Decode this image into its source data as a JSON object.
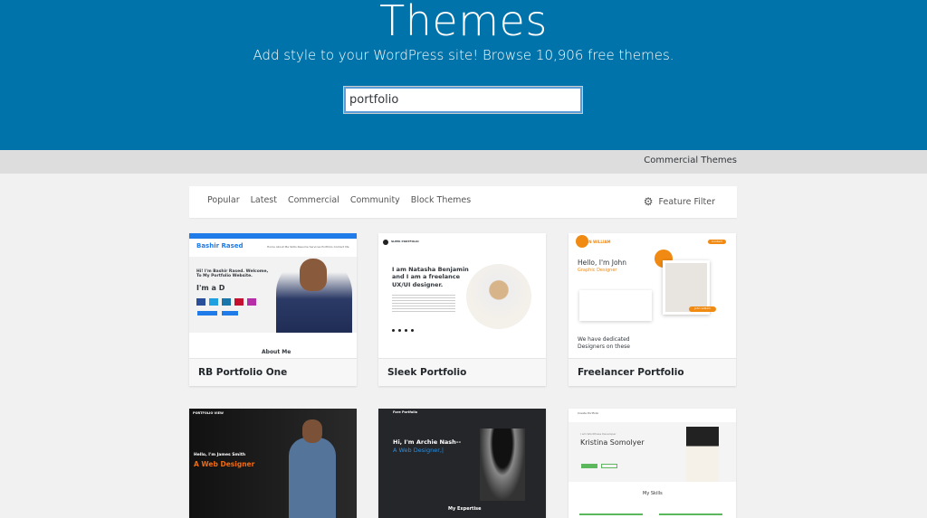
{
  "hero": {
    "title": "Themes",
    "subtitle": "Add style to your WordPress site! Browse 10,906 free themes.",
    "search_value": "portfolio"
  },
  "subbar": {
    "commercial_link": "Commercial Themes"
  },
  "filter": {
    "tabs": [
      "Popular",
      "Latest",
      "Commercial",
      "Community",
      "Block Themes"
    ],
    "feature_filter": "Feature Filter",
    "icon": "gear-icon"
  },
  "themes": [
    {
      "name": "RB Portfolio One",
      "preview": {
        "brand": "Bashir Rased",
        "intro": "Hi! I'm Bashir Rased. Welcome, To My Portfolio Website.",
        "typed": "I'm a D",
        "section": "About Me",
        "nav": "Home  About Me  Skills  Resume  Services  Portfolio  Contact Me"
      }
    },
    {
      "name": "Sleek Portfolio",
      "preview": {
        "brand": "SLEEK PORTFOLIO",
        "headline": "I am Natasha Benjamin and I am a freelance UX/UI designer."
      }
    },
    {
      "name": "Freelancer Portfolio",
      "preview": {
        "brand": "JOHN WILLIAM",
        "headline": "Hello, I'm John",
        "role": "Graphic Designer",
        "section": "We have dedicated Designers on these",
        "button": "Contact",
        "badge": "John william"
      }
    },
    {
      "name": "",
      "preview": {
        "brand": "PORTFOLIO VIEW",
        "greeting": "Hello, I'm James Smith",
        "role": "A Web Designer"
      }
    },
    {
      "name": "",
      "preview": {
        "brand": "Fore Portfolio",
        "headline": "Hi, I'm Archie Nash--",
        "role": "A Web Designer,|",
        "section": "My Expertise"
      }
    },
    {
      "name": "",
      "preview": {
        "brand": "Create Portfolio",
        "tag": "I am WordPress Developer",
        "headline": "Kristina Somolyer",
        "section": "My Skills"
      }
    }
  ],
  "colors": {
    "header": "#0073aa",
    "accent_orange": "#f08a12",
    "accent_blue": "#1e7be8"
  }
}
